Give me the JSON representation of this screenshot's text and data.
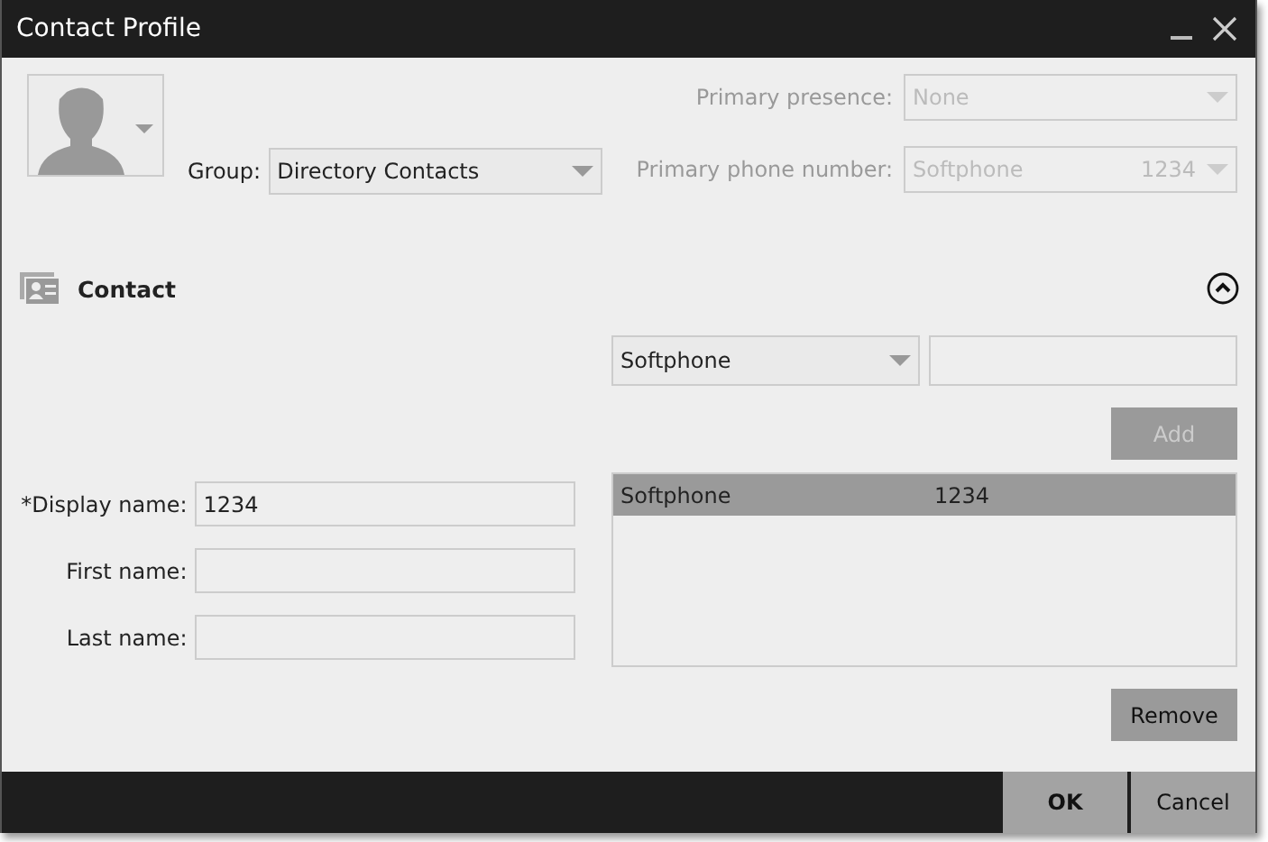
{
  "window": {
    "title": "Contact Profile"
  },
  "group": {
    "label": "Group:",
    "value": "Directory Contacts"
  },
  "primary_presence": {
    "label": "Primary presence:",
    "value": "None",
    "disabled": true
  },
  "primary_phone": {
    "label": "Primary phone number:",
    "type": "Softphone",
    "number": "1234",
    "disabled": true
  },
  "section": {
    "title": "Contact",
    "expanded": true
  },
  "phone_entry": {
    "type": "Softphone"
  },
  "add_button": {
    "label": "Add",
    "disabled": true
  },
  "phone_list": [
    {
      "type": "Softphone",
      "number": "1234",
      "selected": true
    }
  ],
  "remove_button": {
    "label": "Remove"
  },
  "fields": [
    {
      "label": "*Display name:",
      "value": "1234"
    },
    {
      "label": "First name:"
    },
    {
      "label": "Last name:"
    }
  ],
  "buttons": [
    {
      "label": "OK",
      "kind": "primary"
    },
    {
      "label": "Cancel",
      "kind": "secondary"
    }
  ]
}
